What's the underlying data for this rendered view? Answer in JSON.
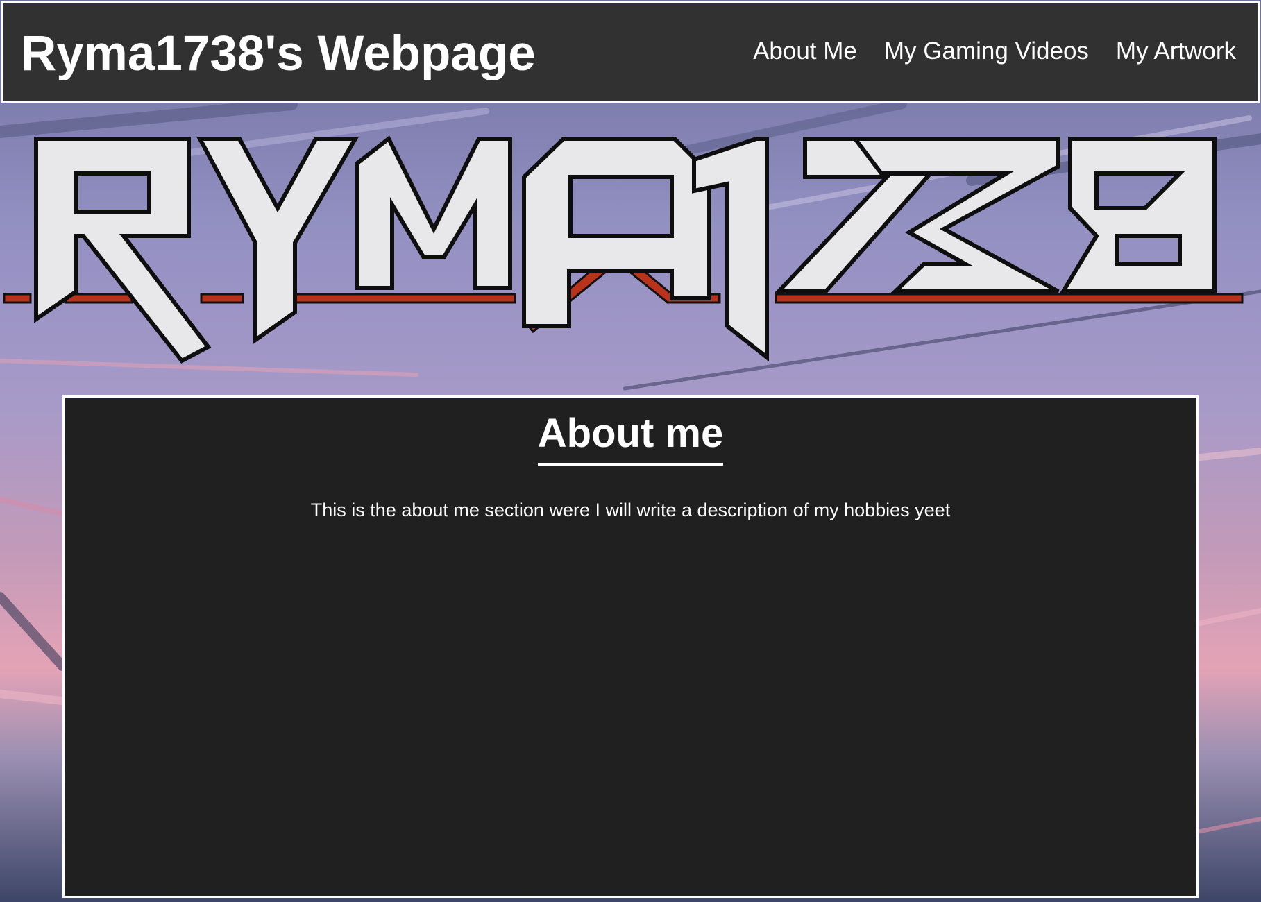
{
  "header": {
    "title": "Ryma1738's Webpage",
    "nav": [
      {
        "label": "About Me"
      },
      {
        "label": "My Gaming Videos"
      },
      {
        "label": "My Artwork"
      }
    ]
  },
  "banner": {
    "logo_text": "RYMA1738"
  },
  "about": {
    "heading": "About me",
    "body": "This is the about me section were I will write a description of my hobbies yeet"
  },
  "colors": {
    "header_bg": "#313131",
    "panel_bg": "#202020",
    "accent_red": "#b8321c",
    "sky_purple": "#8a86b8",
    "sky_pink": "#d98aa8"
  }
}
